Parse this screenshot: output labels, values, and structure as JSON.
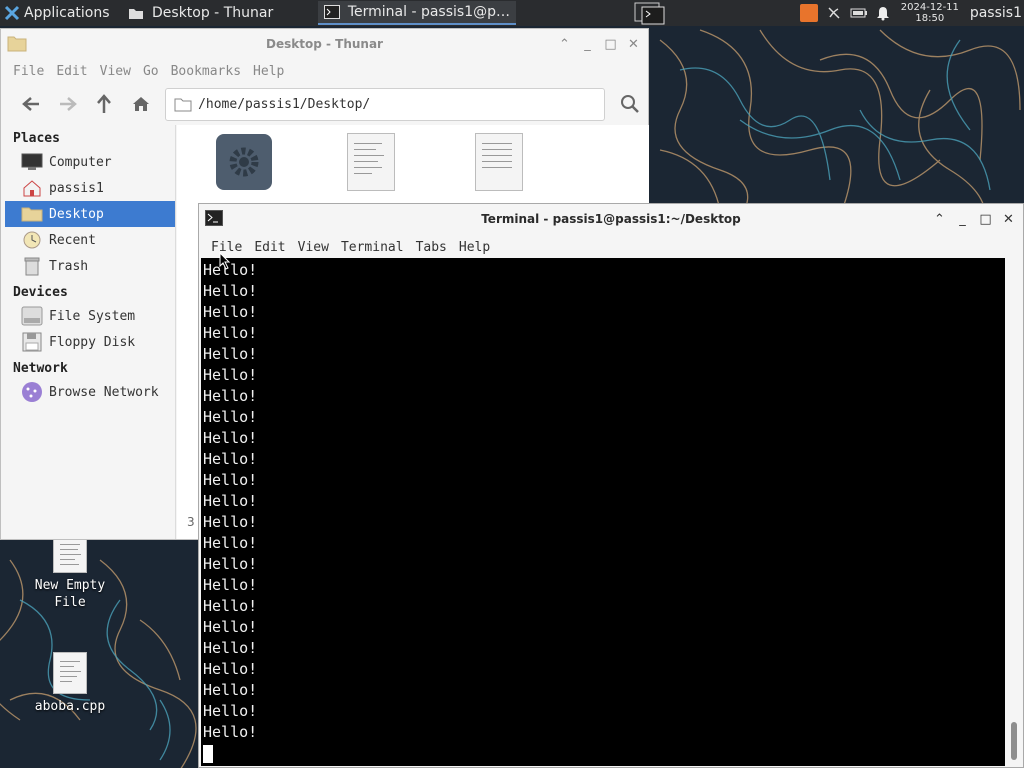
{
  "panel": {
    "applications_label": "Applications",
    "tasks": [
      {
        "label": "Desktop - Thunar"
      },
      {
        "label": "Terminal - passis1@p…"
      }
    ],
    "clock": {
      "date": "2024-12-11",
      "time": "18:50"
    },
    "user": "passis1"
  },
  "desktop_icons": [
    {
      "label": "New Empty File"
    },
    {
      "label": "aboba.cpp"
    }
  ],
  "thunar": {
    "title": "Desktop - Thunar",
    "menu": [
      "File",
      "Edit",
      "View",
      "Go",
      "Bookmarks",
      "Help"
    ],
    "path": "/home/passis1/Desktop/",
    "sections": {
      "places": "Places",
      "devices": "Devices",
      "network": "Network"
    },
    "places": [
      {
        "label": "Computer",
        "icon": "computer-icon"
      },
      {
        "label": "passis1",
        "icon": "home-icon"
      },
      {
        "label": "Desktop",
        "icon": "folder-icon",
        "selected": true
      },
      {
        "label": "Recent",
        "icon": "clock-icon"
      },
      {
        "label": "Trash",
        "icon": "trash-icon"
      }
    ],
    "devices": [
      {
        "label": "File System",
        "icon": "drive-icon"
      },
      {
        "label": "Floppy Disk",
        "icon": "floppy-icon"
      }
    ],
    "network": [
      {
        "label": "Browse Network",
        "icon": "network-icon"
      }
    ],
    "status_text": "3"
  },
  "terminal": {
    "title": "Terminal - passis1@passis1:~/Desktop",
    "menu": [
      "File",
      "Edit",
      "View",
      "Terminal",
      "Tabs",
      "Help"
    ],
    "lines": [
      "Hello!",
      "Hello!",
      "Hello!",
      "Hello!",
      "Hello!",
      "Hello!",
      "Hello!",
      "Hello!",
      "Hello!",
      "Hello!",
      "Hello!",
      "Hello!",
      "Hello!",
      "Hello!",
      "Hello!",
      "Hello!",
      "Hello!",
      "Hello!",
      "Hello!",
      "Hello!",
      "Hello!",
      "Hello!",
      "Hello!"
    ]
  },
  "colors": {
    "desktop_bg": "#1b2633",
    "selection": "#3d7bd0",
    "panel": "#2a2c2f"
  }
}
